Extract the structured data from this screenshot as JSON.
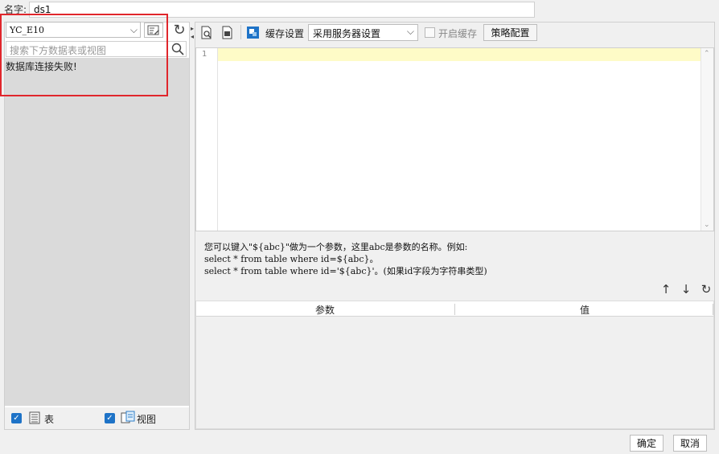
{
  "name_field": {
    "label": "名字:",
    "value": "ds1"
  },
  "left": {
    "db_select": "YC_E10",
    "search_placeholder": "搜索下方数据表或视图",
    "status": "数据库连接失败!",
    "tables_label": "表",
    "views_label": "视图",
    "tables_checked": true,
    "views_checked": true
  },
  "toolbar": {
    "cache_settings_label": "缓存设置",
    "cache_mode": "采用服务器设置",
    "enable_cache_label": "开启缓存",
    "strategy_button": "策略配置"
  },
  "editor": {
    "line_numbers": [
      "1"
    ],
    "content": ""
  },
  "hint": {
    "line1": "您可以键入\"${abc}\"做为一个参数，这里abc是参数的名称。例如:",
    "line2": "select * from table where id=${abc}。",
    "line3": "select * from table where id='${abc}'。(如果id字段为字符串类型)"
  },
  "params": {
    "col_param": "参数",
    "col_value": "值",
    "rows": []
  },
  "footer": {
    "ok": "确定",
    "cancel": "取消"
  },
  "colors": {
    "accent": "#1e73c7",
    "highlight_border": "#e0262c",
    "current_line": "#fefbc7"
  }
}
